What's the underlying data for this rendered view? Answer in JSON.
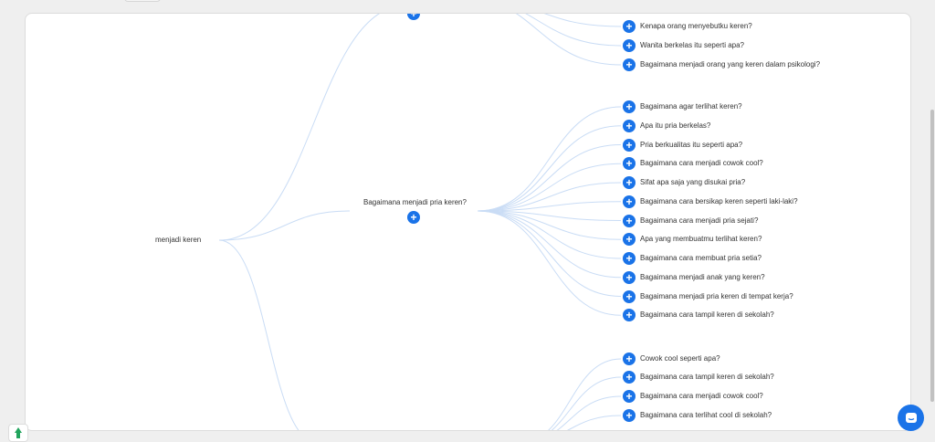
{
  "mindmap": {
    "root": {
      "label": "menjadi keren"
    },
    "branches": [
      {
        "label": "Bagaimana menjadi pria keren?"
      }
    ],
    "questions_top": [
      "Kenapa orang menyebutku keren?",
      "Wanita berkelas itu seperti apa?",
      "Bagaimana menjadi orang yang keren dalam psikologi?"
    ],
    "questions_middle": [
      "Bagaimana agar terlihat keren?",
      "Apa itu pria berkelas?",
      "Pria berkualitas itu seperti apa?",
      "Bagaimana cara menjadi cowok cool?",
      "Sifat apa saja yang disukai pria?",
      "Bagaimana cara bersikap keren seperti laki-laki?",
      "Bagaimana cara menjadi pria sejati?",
      "Apa yang membuatmu terlihat keren?",
      "Bagaimana cara membuat pria setia?",
      "Bagaimana menjadi anak yang keren?",
      "Bagaimana menjadi pria keren di tempat kerja?",
      "Bagaimana cara tampil keren di sekolah?"
    ],
    "questions_bottom": [
      "Cowok cool seperti apa?",
      "Bagaimana cara tampil keren di sekolah?",
      "Bagaimana cara menjadi cowok cool?",
      "Bagaimana cara terlihat cool di sekolah?"
    ]
  },
  "colors": {
    "accent": "#1a73e8",
    "link": "#c9dcf5"
  },
  "icons": {
    "expand": "plus-icon",
    "chat": "chat-icon",
    "feedback": "feedback-icon"
  }
}
